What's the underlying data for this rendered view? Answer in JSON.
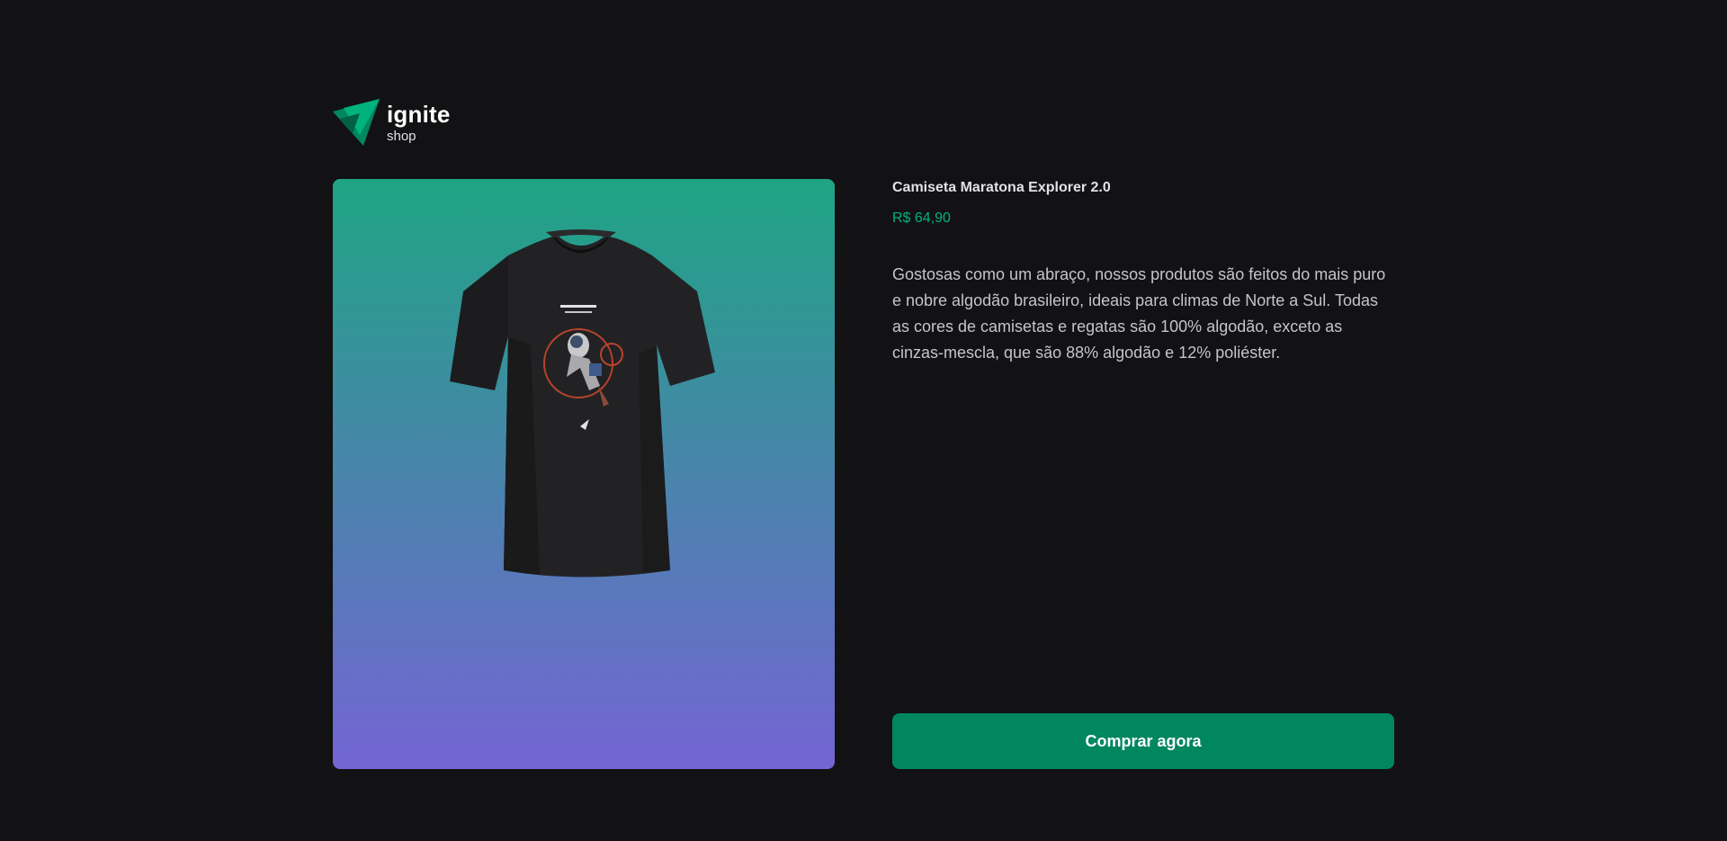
{
  "brand": {
    "logo_icon": "ignite-logo-icon",
    "name": "ignite",
    "sub": "shop",
    "colors": {
      "dark_green": "#00875f",
      "light_green": "#00b37e"
    }
  },
  "product": {
    "image_icon": "tshirt-icon",
    "image_gradient": [
      "#1ea483",
      "#7465d4"
    ],
    "title": "Camiseta Maratona Explorer 2.0",
    "price": "R$ 64,90",
    "description": "Gostosas como um abraço, nossos produtos são feitos do mais puro e nobre algodão brasileiro, ideais para climas de Norte a Sul. Todas as cores de camisetas e regatas são 100% algodão, exceto as cinzas-mescla, que são 88% algodão e 12% poliéster.",
    "buy_label": "Comprar agora"
  },
  "colors": {
    "background": "#121214",
    "title_text": "#e1e1e6",
    "body_text": "#c4c4cc",
    "price": "#00b37e",
    "button": "#00875f"
  }
}
